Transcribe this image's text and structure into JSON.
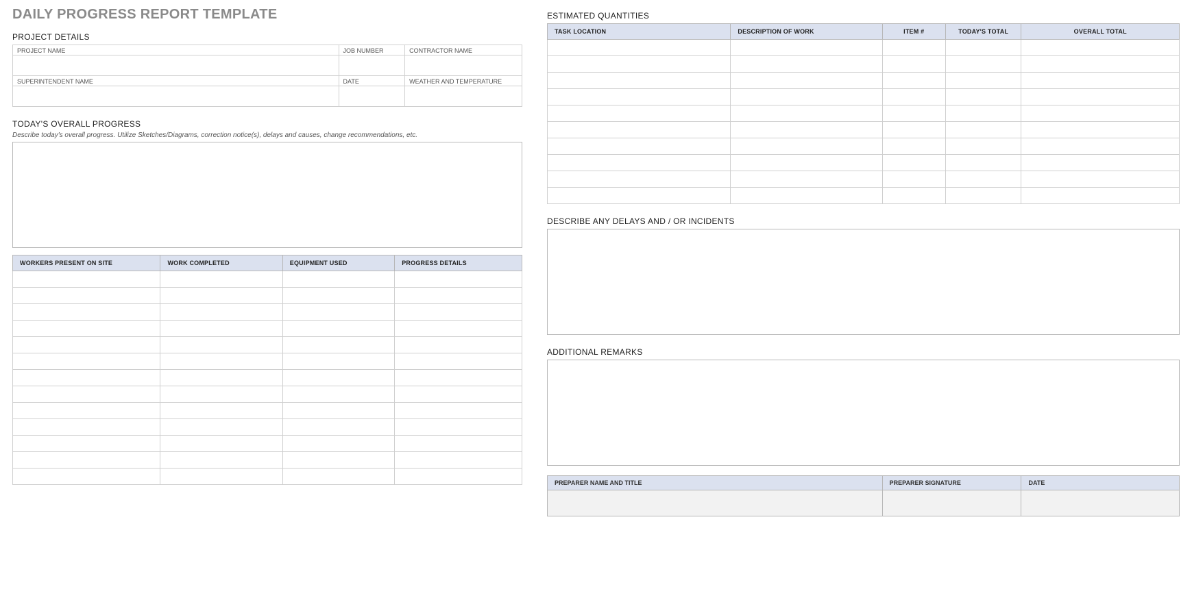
{
  "title": "DAILY PROGRESS REPORT TEMPLATE",
  "sections": {
    "project_details": "PROJECT DETAILS",
    "overall_progress": "TODAY'S OVERALL PROGRESS",
    "estimated_quantities": "ESTIMATED QUANTITIES",
    "delays": "DESCRIBE ANY DELAYS AND / OR INCIDENTS",
    "remarks": "ADDITIONAL REMARKS"
  },
  "hint_overall": "Describe today's overall progress.  Utilize Sketches/Diagrams, correction notice(s), delays and causes, change recommendations, etc.",
  "pd_labels": {
    "project_name": "PROJECT NAME",
    "job_number": "JOB NUMBER",
    "contractor_name": "CONTRACTOR NAME",
    "superintendent_name": "SUPERINTENDENT NAME",
    "date": "DATE",
    "weather": "WEATHER AND TEMPERATURE"
  },
  "pd_values": {
    "project_name": "",
    "job_number": "",
    "contractor_name": "",
    "superintendent_name": "",
    "date": "",
    "weather": ""
  },
  "progress_table": {
    "headers": {
      "workers": "WORKERS PRESENT ON SITE",
      "completed": "WORK COMPLETED",
      "equipment": "EQUIPMENT USED",
      "details": "PROGRESS DETAILS"
    },
    "rows": [
      {
        "workers": "",
        "completed": "",
        "equipment": "",
        "details": ""
      },
      {
        "workers": "",
        "completed": "",
        "equipment": "",
        "details": ""
      },
      {
        "workers": "",
        "completed": "",
        "equipment": "",
        "details": ""
      },
      {
        "workers": "",
        "completed": "",
        "equipment": "",
        "details": ""
      },
      {
        "workers": "",
        "completed": "",
        "equipment": "",
        "details": ""
      },
      {
        "workers": "",
        "completed": "",
        "equipment": "",
        "details": ""
      },
      {
        "workers": "",
        "completed": "",
        "equipment": "",
        "details": ""
      },
      {
        "workers": "",
        "completed": "",
        "equipment": "",
        "details": ""
      },
      {
        "workers": "",
        "completed": "",
        "equipment": "",
        "details": ""
      },
      {
        "workers": "",
        "completed": "",
        "equipment": "",
        "details": ""
      },
      {
        "workers": "",
        "completed": "",
        "equipment": "",
        "details": ""
      },
      {
        "workers": "",
        "completed": "",
        "equipment": "",
        "details": ""
      },
      {
        "workers": "",
        "completed": "",
        "equipment": "",
        "details": ""
      }
    ]
  },
  "quant_table": {
    "headers": {
      "location": "TASK LOCATION",
      "description": "DESCRIPTION OF WORK",
      "item": "ITEM #",
      "today": "TODAY'S TOTAL",
      "overall": "OVERALL TOTAL"
    },
    "rows": [
      {
        "location": "",
        "description": "",
        "item": "",
        "today": "",
        "overall": ""
      },
      {
        "location": "",
        "description": "",
        "item": "",
        "today": "",
        "overall": ""
      },
      {
        "location": "",
        "description": "",
        "item": "",
        "today": "",
        "overall": ""
      },
      {
        "location": "",
        "description": "",
        "item": "",
        "today": "",
        "overall": ""
      },
      {
        "location": "",
        "description": "",
        "item": "",
        "today": "",
        "overall": ""
      },
      {
        "location": "",
        "description": "",
        "item": "",
        "today": "",
        "overall": ""
      },
      {
        "location": "",
        "description": "",
        "item": "",
        "today": "",
        "overall": ""
      },
      {
        "location": "",
        "description": "",
        "item": "",
        "today": "",
        "overall": ""
      },
      {
        "location": "",
        "description": "",
        "item": "",
        "today": "",
        "overall": ""
      },
      {
        "location": "",
        "description": "",
        "item": "",
        "today": "",
        "overall": ""
      }
    ]
  },
  "signoff": {
    "headers": {
      "name": "PREPARER NAME AND TITLE",
      "signature": "PREPARER SIGNATURE",
      "date": "DATE"
    },
    "values": {
      "name": "",
      "signature": "",
      "date": ""
    }
  },
  "boxes": {
    "overall": "",
    "delays": "",
    "remarks": ""
  }
}
